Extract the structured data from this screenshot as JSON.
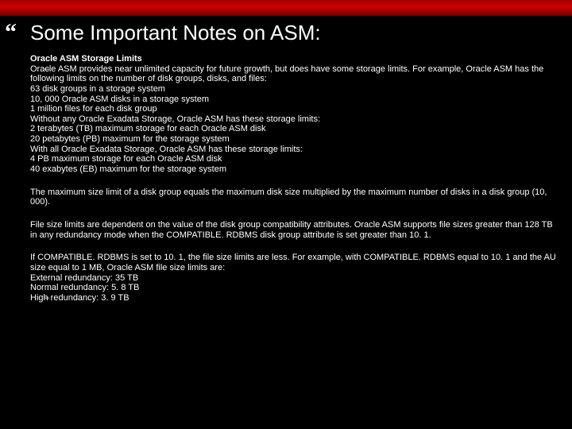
{
  "title": "Some Important Notes on ASM:",
  "left_accent": "“",
  "bullets": [
    {
      "level": 0,
      "bold": true,
      "text": "Oracle ASM Storage Limits"
    },
    {
      "level": 1,
      "text": "Oracle ASM provides near unlimited capacity for future growth, but does have some storage limits. For example, Oracle ASM has the following limits on the number of disk groups, disks, and files:"
    },
    {
      "level": 2,
      "text": "63 disk groups in a storage system"
    },
    {
      "level": 2,
      "text": "10, 000 Oracle ASM disks in a storage system"
    },
    {
      "level": 2,
      "text": "1 million files for each disk group"
    },
    {
      "level": 0,
      "text": "Without any Oracle Exadata Storage, Oracle ASM has these storage limits:"
    },
    {
      "level": 3,
      "text": "2 terabytes (TB) maximum storage for each Oracle ASM disk"
    },
    {
      "level": 3,
      "text": "20 petabytes (PB) maximum for the storage system"
    },
    {
      "level": 0,
      "text": "With all Oracle Exadata Storage, Oracle ASM has these storage limits:"
    },
    {
      "level": 3,
      "text": "4 PB maximum storage for each Oracle ASM disk"
    },
    {
      "level": 3,
      "text": "40 exabytes (EB) maximum for the storage system"
    },
    {
      "level": 0,
      "gap": true,
      "text": "The maximum size limit of a disk group equals the maximum disk size multiplied by the maximum number of disks in a disk group (10, 000)."
    },
    {
      "level": 0,
      "gap": true,
      "text": "File size limits are dependent on the value of the disk group compatibility attributes. Oracle ASM supports file sizes greater than 128 TB in any redundancy mode when the COMPATIBLE. RDBMS disk group attribute is set greater than 10. 1."
    },
    {
      "level": 0,
      "gap": true,
      "text": "If COMPATIBLE. RDBMS is set to 10. 1, the file size limits are less. For example, with COMPATIBLE. RDBMS equal to 10. 1 and the AU size equal to 1 MB, Oracle ASM file size limits are:"
    },
    {
      "level": 3,
      "text": "External redundancy: 35 TB"
    },
    {
      "level": 3,
      "text": "Normal redundancy: 5. 8 TB"
    },
    {
      "level": 1,
      "text": "High redundancy: 3. 9 TB"
    }
  ]
}
